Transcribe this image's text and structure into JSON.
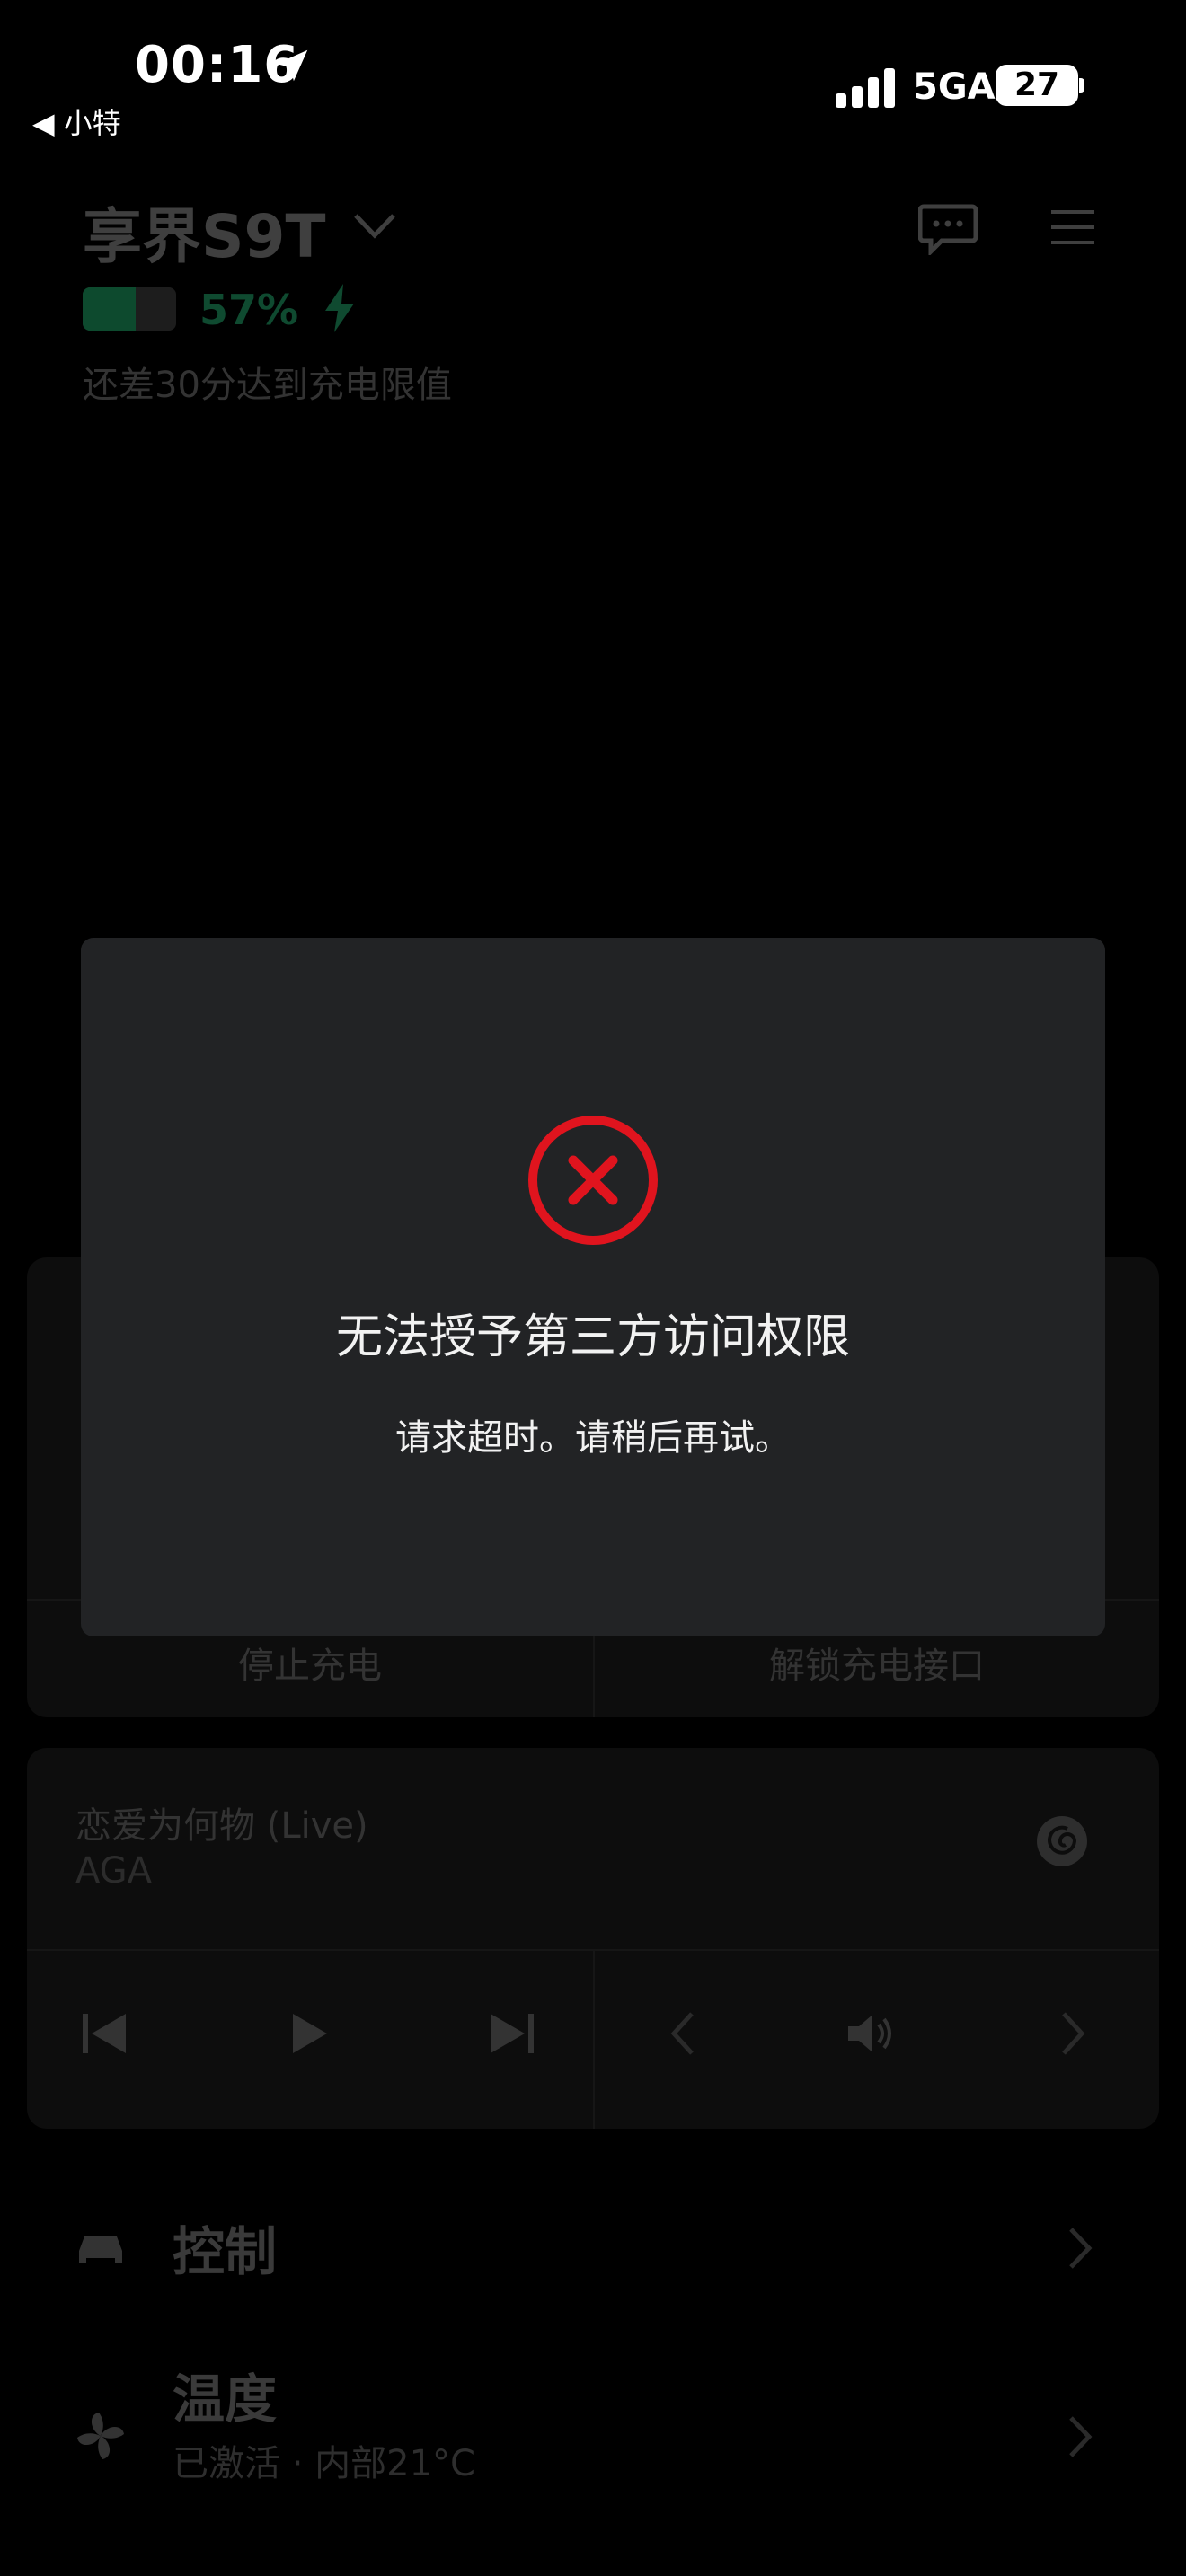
{
  "status_bar": {
    "time": "00:16",
    "back_label": "◀ 小特",
    "network": "5GA",
    "battery": "27"
  },
  "header": {
    "car_name": "享界S9T",
    "battery_percent": "57%",
    "battery_level": 0.57,
    "charge_note": "还差30分达到充电限值"
  },
  "charging_card": {
    "stop_label": "停止充电",
    "unlock_label": "解锁充电接口"
  },
  "media": {
    "song_title": "恋爱为何物 (Live)",
    "artist": "AGA"
  },
  "menu": {
    "control_label": "控制",
    "temperature_label": "温度",
    "temperature_status": "已激活 · 内部21°C"
  },
  "dialog": {
    "title": "无法授予第三方访问权限",
    "message": "请求超时。请稍后再试。"
  },
  "colors": {
    "error_red": "#e0141e",
    "dialog_bg": "#222325",
    "battery_green": "#0d4a2e"
  }
}
